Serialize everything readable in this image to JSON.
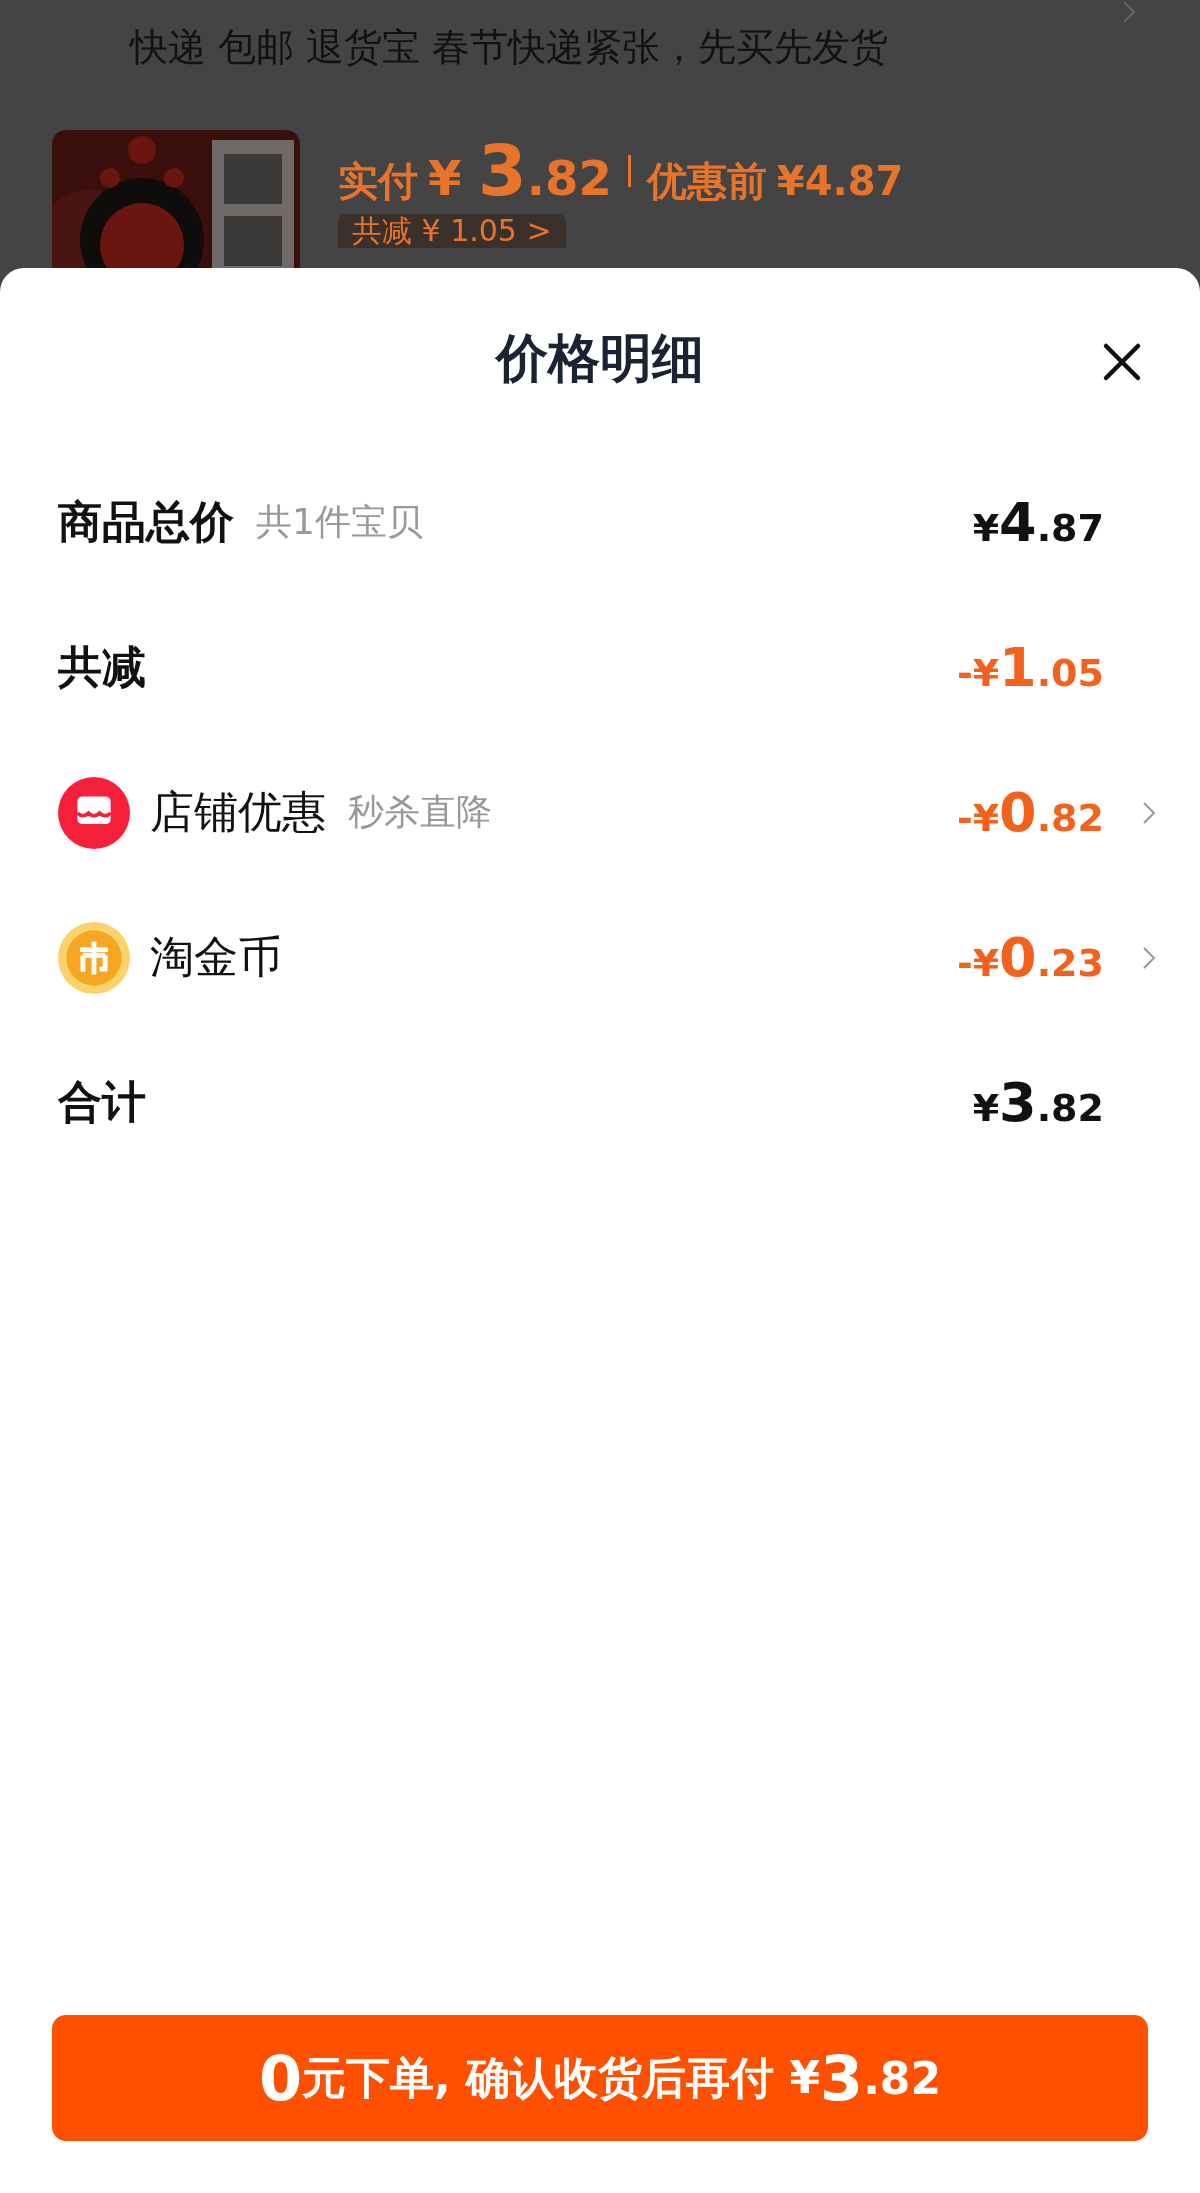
{
  "background_page": {
    "shipping_note": "快递 包邮 退货宝 春节快递紧张，先买先发货",
    "product": {
      "paid_label": "实付",
      "paid_price": "¥ 3.82",
      "original_label": "优惠前",
      "original_price": "¥4.87",
      "discount_badge": "共减 ¥ 1.05 >"
    }
  },
  "sheet": {
    "title": "价格明细",
    "rows": [
      {
        "kind": "total",
        "label": "商品总价",
        "note": "共1件宝贝",
        "amount": "¥4.87",
        "discount": false,
        "chevron": false
      },
      {
        "kind": "plain",
        "label": "共减",
        "amount": "-¥1.05",
        "discount": true,
        "chevron": false
      },
      {
        "kind": "shop",
        "label": "店铺优惠",
        "note": "秒杀直降",
        "amount": "-¥0.82",
        "discount": true,
        "chevron": true
      },
      {
        "kind": "coin",
        "label": "淘金币",
        "amount": "-¥0.23",
        "discount": true,
        "chevron": true
      },
      {
        "kind": "plain",
        "label": "合计",
        "amount": "¥3.82",
        "discount": false,
        "chevron": false
      }
    ],
    "pay_button": "0元下单, 确认收货后再付 ¥3.82"
  }
}
